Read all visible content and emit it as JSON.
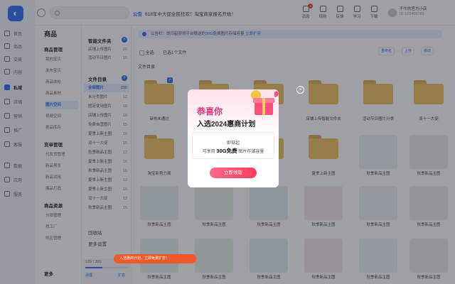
{
  "rail": {
    "items": [
      {
        "label": "首页"
      },
      {
        "label": "商品"
      },
      {
        "label": "交易"
      },
      {
        "label": "内容"
      },
      {
        "label": "私域"
      },
      {
        "label": "店铺"
      },
      {
        "label": "营销"
      },
      {
        "label": "推广"
      },
      {
        "label": "客服"
      },
      {
        "label": "数据"
      },
      {
        "label": "应用"
      },
      {
        "label": "服务"
      }
    ]
  },
  "topbar": {
    "notice_tag": "公告",
    "notice_text": "618年中大促全民狂欢！淘宝商家报名开始！",
    "actions": [
      {
        "label": "消息",
        "badge": "1"
      },
      {
        "label": "规则",
        "badge": ""
      },
      {
        "label": "反馈",
        "badge": ""
      },
      {
        "label": "学习",
        "badge": ""
      },
      {
        "label": "下载",
        "badge": ""
      }
    ],
    "shop_name": "千牛的官方小店",
    "shop_sub": "ID:123456789"
  },
  "sidebar": {
    "title": "商品",
    "groups": [
      {
        "heading": "商品管理",
        "items": [
          "我的宝贝",
          "发布宝贝",
          "商品体检",
          "商品素材",
          "图片空间",
          "视频空间",
          "挑品库存"
        ]
      },
      {
        "heading": "货单管理",
        "items": [
          "代发货管理",
          "新品预览",
          "新品试用",
          "爆品打造"
        ]
      },
      {
        "heading": "商品资源",
        "items": [
          "分销管理",
          "找工厂",
          "供应管理"
        ]
      }
    ],
    "more": "更多"
  },
  "folders": {
    "smart_heading": "智能文件夹",
    "smart": [
      {
        "name": "店铺上传图片",
        "count": "20"
      },
      {
        "name": "活动节日图片",
        "count": "16"
      }
    ],
    "dir_heading": "文件目录",
    "dirs": [
      {
        "name": "全部图片",
        "count": "230"
      },
      {
        "name": "未分类图片",
        "count": "12"
      },
      {
        "name": "固定使用图片",
        "count": "18"
      },
      {
        "name": "店铺上传图片",
        "count": "16"
      },
      {
        "name": "免费自营图片",
        "count": "15"
      },
      {
        "name": "夏季上新主图",
        "count": "16"
      },
      {
        "name": "双十一大促",
        "count": "15"
      },
      {
        "name": "秋季新品主图",
        "count": "12"
      },
      {
        "name": "夏季上新主图",
        "count": "16"
      },
      {
        "name": "秋季新品主图",
        "count": "15"
      },
      {
        "name": "夏季上新主图",
        "count": "12"
      },
      {
        "name": "夏季上新主图",
        "count": "15"
      },
      {
        "name": "双十一大促",
        "count": "12"
      },
      {
        "name": "秋季新品主图",
        "count": "15"
      }
    ],
    "recycle": "回收站",
    "more_settings": "更多设置",
    "storage": "12G / 30G",
    "storage_used_fraction": 0.4,
    "clean": "清理",
    "expand": "扩容"
  },
  "main": {
    "banner_prefix": "公告栏：",
    "banner_text": "即日起获得平台赠送的",
    "banner_highlight": "30G",
    "banner_tail": "免费图片存储容量",
    "banner_link": "立即扩容",
    "select_all": "全选",
    "selected": "已选1个文件",
    "btn_rename": "重命名",
    "btn_upload": "上传",
    "btn_move": "移动",
    "dir_label": "文件目录",
    "row1": [
      "审核未通过",
      "",
      "",
      "店铺上传智能文件夹",
      "活动节日图片分类",
      "双十一大促"
    ],
    "row2": [
      "淘宝新势力周",
      "",
      "",
      "夏季上新主图",
      "秋季新品主图",
      "秋季新品主图"
    ],
    "row3": [
      "秋季新品主图",
      "秋季新品主图",
      "秋季新品主图",
      "秋季新品主图",
      "秋季新品主图",
      "秋季新品主图"
    ],
    "row4": [
      "秋季新品主图",
      "秋季新品主图",
      "秋季新品主图",
      "秋季新品主图",
      "秋季新品主图",
      "秋季新品主图"
    ]
  },
  "popup": {
    "title1": "恭喜你",
    "title2": "入选2024惠商计划",
    "line1": "即日起",
    "line2_pre": "可享用",
    "line2_bold": "30G免费",
    "line2_post": "图片存储容量",
    "button": "立即领取",
    "close": "×"
  },
  "toast": "入选惠商计划，立即免费扩容！",
  "colors": {
    "accent": "#2b6bf3",
    "popup_pink": "#e8327a",
    "folder": "#f0c25a"
  }
}
